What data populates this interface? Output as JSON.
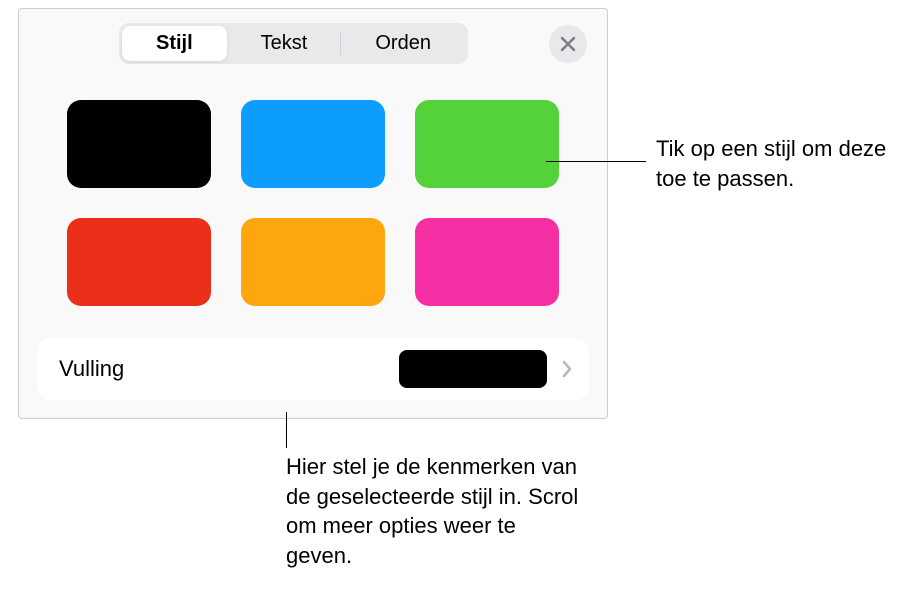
{
  "tabs": {
    "items": [
      {
        "label": "Stijl",
        "active": true
      },
      {
        "label": "Tekst",
        "active": false
      },
      {
        "label": "Orden",
        "active": false
      }
    ]
  },
  "swatches": [
    {
      "color": "#000000"
    },
    {
      "color": "#0d9dff"
    },
    {
      "color": "#54d239"
    },
    {
      "color": "#ec2f19"
    },
    {
      "color": "#fea60d"
    },
    {
      "color": "#f62fa4"
    }
  ],
  "fill": {
    "label": "Vulling",
    "preview_color": "#000000"
  },
  "callouts": {
    "apply_style": "Tik op een stijl om deze toe te passen.",
    "set_attributes": "Hier stel je de kenmerken van de geselecteerde stijl in. Scrol om meer opties weer te geven."
  }
}
